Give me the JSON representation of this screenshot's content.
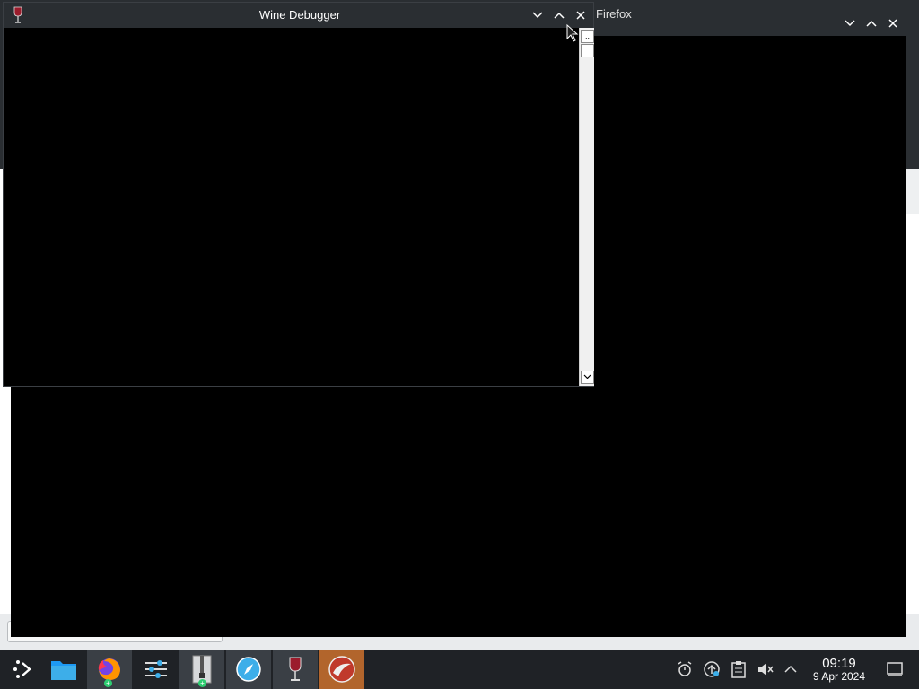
{
  "background_window": {
    "title": "Firefox"
  },
  "wine_debugger": {
    "title": "Wine Debugger",
    "scroll_up": "..",
    "scroll_down": "⌄"
  },
  "taskbar": {
    "apps": [
      "app-launcher",
      "file-manager",
      "firefox",
      "settings",
      "archive-manager",
      "browser",
      "wine",
      "app"
    ],
    "clock": {
      "time": "09:19",
      "date": "9 Apr 2024"
    }
  },
  "colors": {
    "taskbar": "#1f2226",
    "titlebar": "#2a2e32",
    "orange_task": "#b2652c"
  }
}
